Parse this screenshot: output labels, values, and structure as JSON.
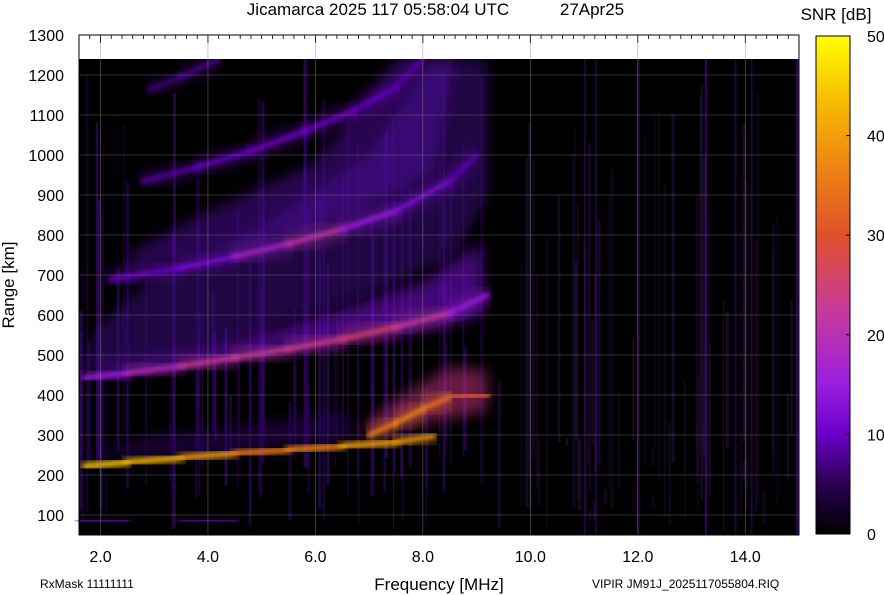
{
  "chart_data": {
    "type": "heatmap",
    "title": "Jicamarca 2025 117 05:58:04 UTC",
    "date_label": "27Apr25",
    "xlabel": "Frequency [MHz]",
    "ylabel": "Range [km]",
    "xlim": [
      1.6,
      15.0
    ],
    "ylim": [
      50,
      1300
    ],
    "x_ticks": [
      "2.0",
      "4.0",
      "6.0",
      "8.0",
      "10.0",
      "12.0",
      "14.0"
    ],
    "y_ticks": [
      "100",
      "200",
      "300",
      "400",
      "500",
      "600",
      "700",
      "800",
      "900",
      "1000",
      "1100",
      "1200",
      "1300"
    ],
    "colorbar": {
      "label": "SNR [dB]",
      "range": [
        0,
        50
      ],
      "ticks": [
        "0",
        "10",
        "20",
        "30",
        "40",
        "50"
      ],
      "colormap": [
        "#000000",
        "#2a0050",
        "#6a00c8",
        "#9a1ee0",
        "#c83a9a",
        "#e0502a",
        "#f08a10",
        "#f8c000",
        "#ffff00"
      ]
    },
    "grid": true,
    "traces": [
      {
        "name": "",
        "x": [
          1.7,
          2.5,
          3.5,
          4.5,
          5.5,
          6.5,
          7.5,
          8.2
        ],
        "y": [
          222,
          232,
          243,
          254,
          263,
          272,
          282,
          297
        ],
        "snr": [
          45,
          44,
          42,
          38,
          34,
          40,
          42,
          36
        ]
      },
      {
        "name": "",
        "x": [
          1.7,
          2.5,
          3.5,
          4.5,
          5.5,
          6.5,
          7.5,
          8.5,
          9.2
        ],
        "y": [
          443,
          455,
          472,
          493,
          515,
          540,
          570,
          605,
          650
        ],
        "snr": [
          18,
          20,
          24,
          26,
          24,
          27,
          28,
          22,
          15
        ]
      },
      {
        "name": "",
        "x": [
          2.2,
          3.5,
          4.5,
          5.5,
          6.5,
          7.5,
          8.5,
          9.0
        ],
        "y": [
          690,
          718,
          746,
          778,
          815,
          860,
          935,
          1000
        ],
        "snr": [
          12,
          14,
          15,
          26,
          22,
          16,
          13,
          10
        ]
      },
      {
        "name": "",
        "x": [
          2.8,
          3.8,
          4.8,
          5.8,
          6.7,
          7.5,
          8.0
        ],
        "y": [
          935,
          970,
          1010,
          1060,
          1110,
          1170,
          1240
        ],
        "snr": [
          10,
          12,
          13,
          14,
          13,
          11,
          10
        ]
      },
      {
        "name": "",
        "x": [
          2.9,
          3.5,
          4.2
        ],
        "y": [
          1163,
          1195,
          1240
        ],
        "snr": [
          8,
          9,
          10
        ]
      },
      {
        "name": "",
        "x": [
          1.6,
          2.5,
          3.5,
          4.5,
          5.2
        ],
        "y": [
          86,
          85,
          85,
          86,
          86
        ],
        "snr": [
          14,
          13,
          12,
          11,
          10
        ]
      },
      {
        "name": "",
        "x": [
          7.0,
          7.5,
          8.0,
          8.5,
          9.2
        ],
        "y": [
          300,
          330,
          365,
          395,
          400
        ],
        "snr": [
          35,
          38,
          36,
          34,
          28
        ]
      }
    ]
  },
  "footer": {
    "rxmask": "RxMask 11111111",
    "filename": "VIPIR  JM91J_2025117055804.RIQ"
  }
}
